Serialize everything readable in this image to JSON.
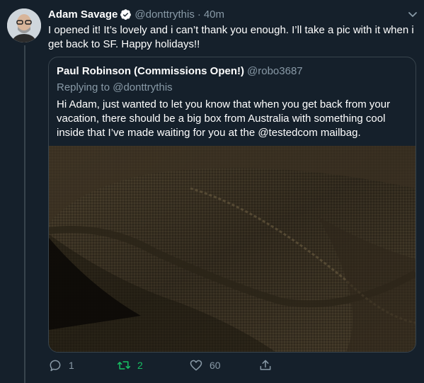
{
  "tweet": {
    "author_name": "Adam Savage",
    "author_handle": "@donttrythis",
    "separator": "·",
    "time": "40m",
    "text": "I opened it! It’s lovely and i can’t thank you enough. I’ll take a pic with it when i get back to SF.  Happy holidays!!"
  },
  "quoted": {
    "author_name": "Paul Robinson (Commissions Open!)",
    "author_handle": "@robo3687",
    "replying_prefix": "Replying to",
    "replying_handle": "@donttrythis",
    "text": "Hi Adam, just wanted to let you know that when you get back from your vacation, there should be a big box from Australia with something cool inside that I’ve made waiting for you at the @testedcom mailbag."
  },
  "actions": {
    "reply_count": "1",
    "retweet_count": "2",
    "like_count": "60"
  },
  "colors": {
    "background": "#15202b",
    "border": "#38444d",
    "secondary_text": "#8899a6",
    "accent": "#1da1f2",
    "retweet_active": "#17bf63"
  },
  "icons": [
    "verified-badge-icon",
    "chevron-down-icon",
    "reply-icon",
    "retweet-icon",
    "like-icon",
    "share-icon"
  ]
}
